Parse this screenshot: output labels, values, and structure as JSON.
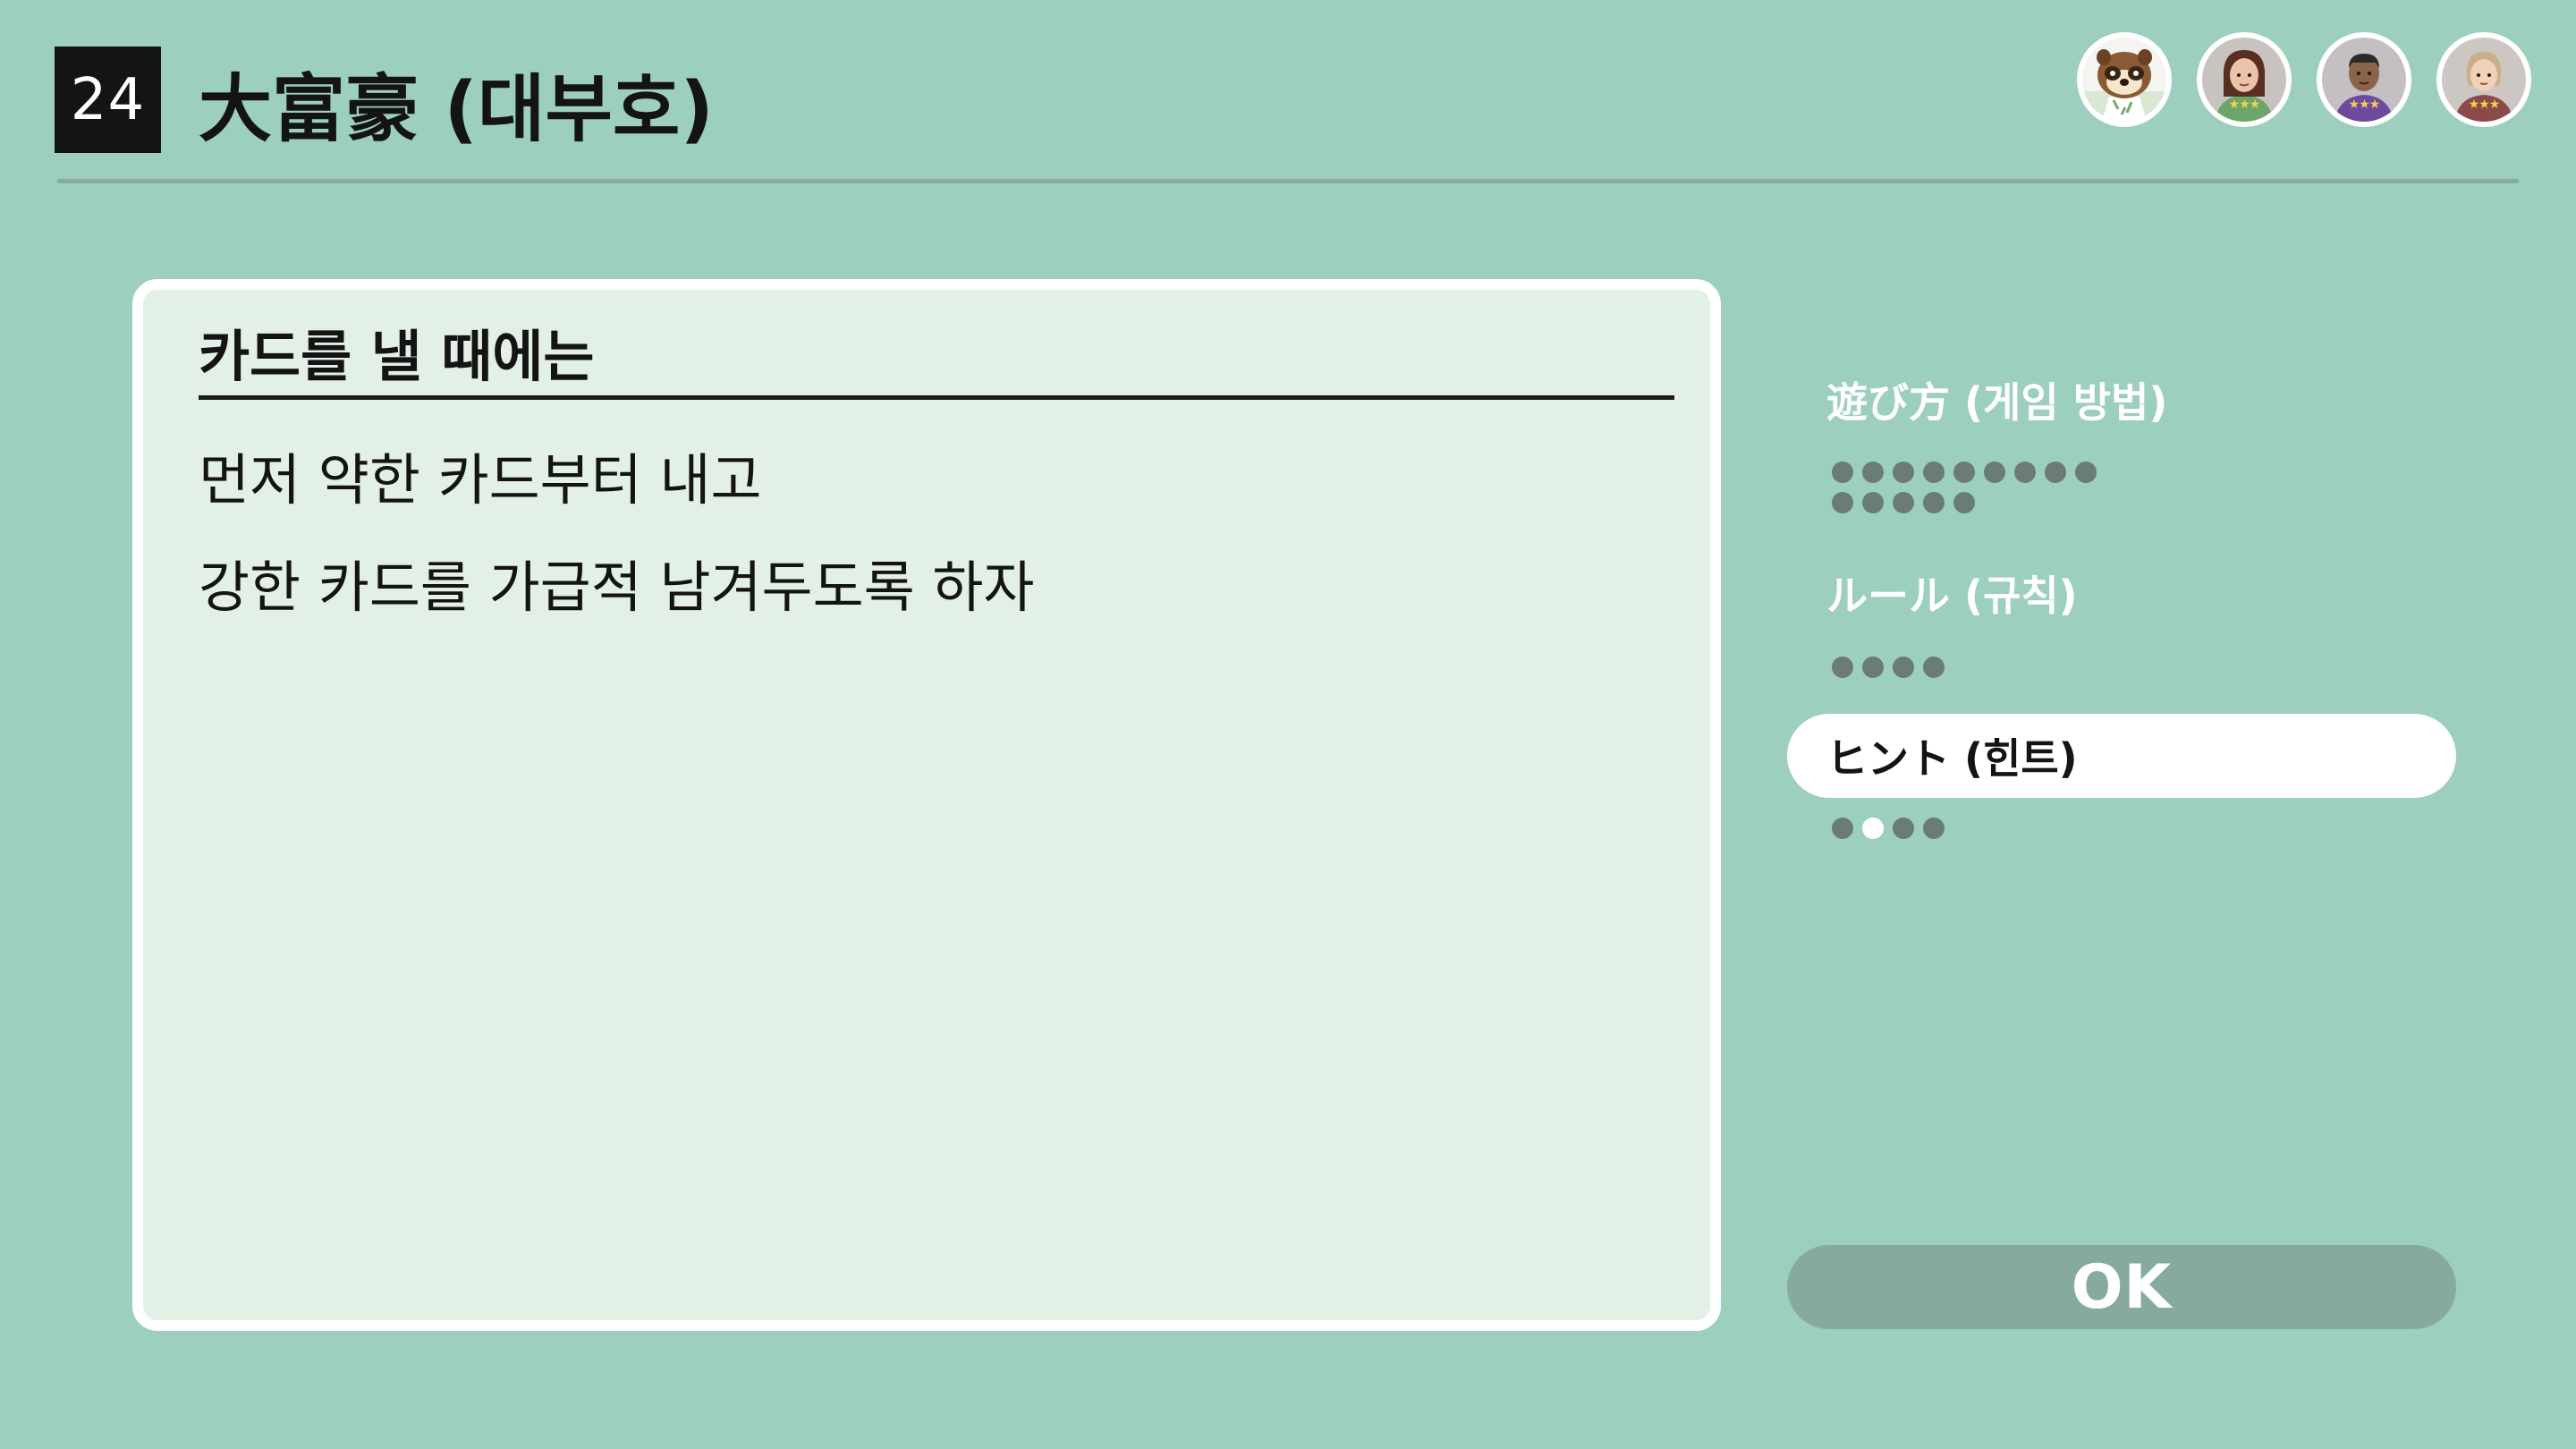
{
  "header": {
    "game_number": "24",
    "title": "大富豪 (대부호)"
  },
  "players": [
    {
      "name": "tanuki-avatar",
      "type": "character"
    },
    {
      "name": "player-avatar-2",
      "type": "mii",
      "stars": "★★★"
    },
    {
      "name": "player-avatar-3",
      "type": "mii",
      "stars": "★★★"
    },
    {
      "name": "player-avatar-4",
      "type": "mii",
      "stars": "★★★"
    }
  ],
  "card": {
    "heading": "카드를 낼 때에는",
    "lines": [
      "먼저 약한 카드부터 내고",
      "강한 카드를 가급적 남겨두도록 하자"
    ]
  },
  "menu": {
    "items": [
      {
        "label": "遊び方 (게임 방법)",
        "pages": 14,
        "current": null
      },
      {
        "label": "ルール (규칙)",
        "pages": 4,
        "current": null
      },
      {
        "label": "ヒント (힌트)",
        "pages": 4,
        "current": 2,
        "selected": true
      }
    ]
  },
  "ok_button": {
    "label": "OK"
  },
  "colors": {
    "background": "#9ccfbd",
    "card": "#e3f0e6",
    "ok_button": "#86ab9d",
    "dot": "#6b7c74"
  }
}
